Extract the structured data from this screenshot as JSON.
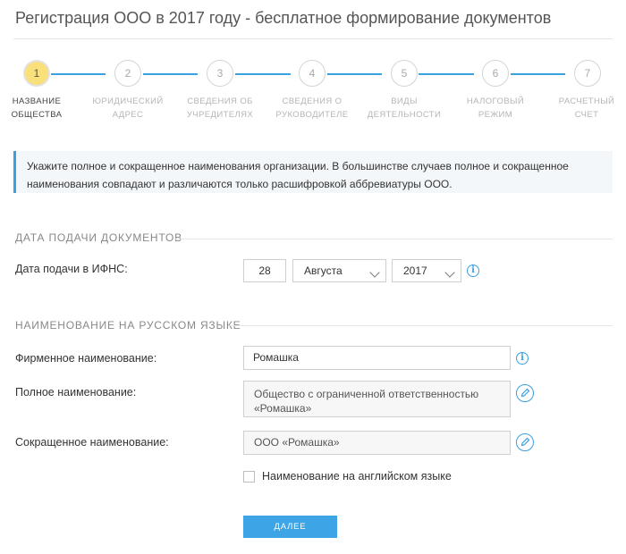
{
  "page_title": "Регистрация ООО в 2017 году - бесплатное формирование документов",
  "steps": [
    {
      "num": "1",
      "label1": "Название",
      "label2": "общества",
      "active": true
    },
    {
      "num": "2",
      "label1": "Юридический",
      "label2": "адрес",
      "active": false
    },
    {
      "num": "3",
      "label1": "Сведения об",
      "label2": "учредителях",
      "active": false
    },
    {
      "num": "4",
      "label1": "Сведения о",
      "label2": "руководителе",
      "active": false
    },
    {
      "num": "5",
      "label1": "Виды",
      "label2": "деятельности",
      "active": false
    },
    {
      "num": "6",
      "label1": "Налоговый",
      "label2": "режим",
      "active": false
    },
    {
      "num": "7",
      "label1": "Расчетный",
      "label2": "счет",
      "active": false
    }
  ],
  "info_text": "Укажите полное и сокращенное наименования организации. В большинстве случаев полное и сокращенное наименования совпадают и различаются только расшифровкой аббревиатуры ООО.",
  "section_date": {
    "heading": "Дата подачи документов",
    "label": "Дата подачи в ИФНС:",
    "day": "28",
    "month": "Августа",
    "year": "2017"
  },
  "section_name": {
    "heading": "Наименование на русском языке",
    "brand_label": "Фирменное наименование:",
    "brand_value": "Ромашка",
    "full_label": "Полное наименование:",
    "full_value_line1": "Общество с ограниченной ответственностью",
    "full_value_line2": "«Ромашка»",
    "short_label": "Сокращенное наименование:",
    "short_value": "ООО «Ромашка»",
    "english_checkbox_label": "Наименование на английском языке"
  },
  "next_button": "ДАЛЕЕ",
  "colors": {
    "accent": "#3aa0e0",
    "active_step": "#f9e07a",
    "button": "#3da5e6"
  }
}
